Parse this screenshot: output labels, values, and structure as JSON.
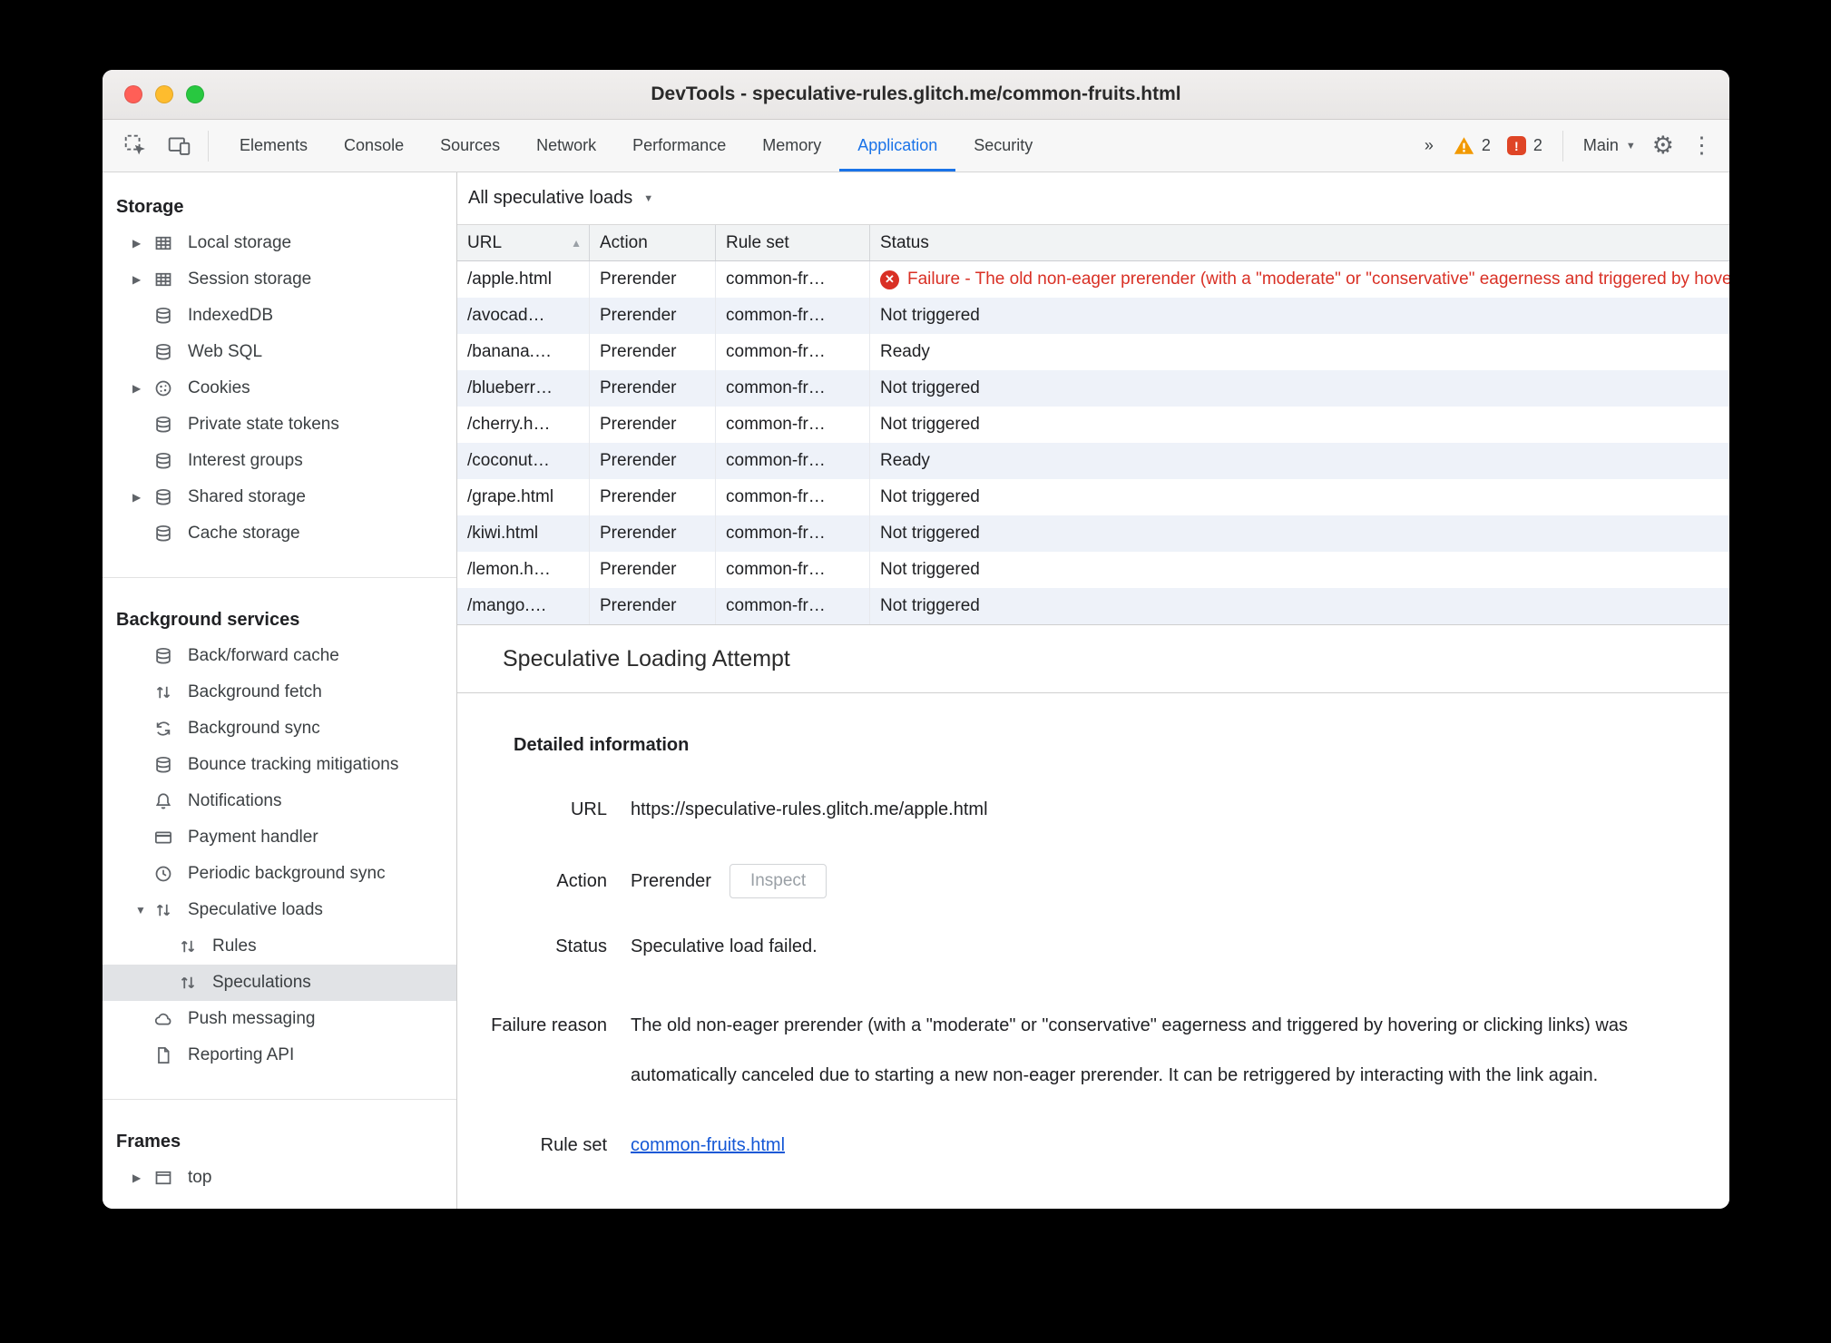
{
  "window": {
    "title": "DevTools - speculative-rules.glitch.me/common-fruits.html"
  },
  "toolbar": {
    "tabs": {
      "elements": "Elements",
      "console": "Console",
      "sources": "Sources",
      "network": "Network",
      "performance": "Performance",
      "memory": "Memory",
      "application": "Application",
      "security": "Security"
    },
    "more_tabs_symbol": "»",
    "warning_count": "2",
    "issue_count": "2",
    "main_menu_label": "Main"
  },
  "sidebar": {
    "storage": {
      "title": "Storage",
      "items": [
        "Local storage",
        "Session storage",
        "IndexedDB",
        "Web SQL",
        "Cookies",
        "Private state tokens",
        "Interest groups",
        "Shared storage",
        "Cache storage"
      ]
    },
    "background": {
      "title": "Background services",
      "items": [
        "Back/forward cache",
        "Background fetch",
        "Background sync",
        "Bounce tracking mitigations",
        "Notifications",
        "Payment handler",
        "Periodic background sync",
        "Speculative loads",
        "Rules",
        "Speculations",
        "Push messaging",
        "Reporting API"
      ]
    },
    "frames": {
      "title": "Frames",
      "items": [
        "top"
      ]
    }
  },
  "filter": {
    "label": "All speculative loads"
  },
  "grid": {
    "columns": {
      "url": "URL",
      "action": "Action",
      "rule_set": "Rule set",
      "status": "Status"
    },
    "rows": [
      {
        "url": "/apple.html",
        "action": "Prerender",
        "rule_set": "common-fr…",
        "status": "Failure - The old non-eager prerender (with a \"moderate\" or \"conservative\" eagerness and triggered by hovering or clicking links) was automatically canceled"
      },
      {
        "url": "/avocad…",
        "action": "Prerender",
        "rule_set": "common-fr…",
        "status": "Not triggered"
      },
      {
        "url": "/banana.…",
        "action": "Prerender",
        "rule_set": "common-fr…",
        "status": "Ready"
      },
      {
        "url": "/blueberr…",
        "action": "Prerender",
        "rule_set": "common-fr…",
        "status": "Not triggered"
      },
      {
        "url": "/cherry.h…",
        "action": "Prerender",
        "rule_set": "common-fr…",
        "status": "Not triggered"
      },
      {
        "url": "/coconut…",
        "action": "Prerender",
        "rule_set": "common-fr…",
        "status": "Ready"
      },
      {
        "url": "/grape.html",
        "action": "Prerender",
        "rule_set": "common-fr…",
        "status": "Not triggered"
      },
      {
        "url": "/kiwi.html",
        "action": "Prerender",
        "rule_set": "common-fr…",
        "status": "Not triggered"
      },
      {
        "url": "/lemon.h…",
        "action": "Prerender",
        "rule_set": "common-fr…",
        "status": "Not triggered"
      },
      {
        "url": "/mango.…",
        "action": "Prerender",
        "rule_set": "common-fr…",
        "status": "Not triggered"
      }
    ]
  },
  "details": {
    "panel_title": "Speculative Loading Attempt",
    "section_title": "Detailed information",
    "url": {
      "label": "URL",
      "value": "https://speculative-rules.glitch.me/apple.html"
    },
    "action": {
      "label": "Action",
      "value": "Prerender",
      "button": "Inspect"
    },
    "status": {
      "label": "Status",
      "value": "Speculative load failed."
    },
    "failure": {
      "label": "Failure reason",
      "value": "The old non-eager prerender (with a \"moderate\" or \"conservative\" eagerness and triggered by hovering or clicking links) was automatically canceled due to starting a new non-eager prerender. It can be retriggered by interacting with the link again."
    },
    "rule_set": {
      "label": "Rule set",
      "value": "common-fruits.html"
    }
  },
  "colors": {
    "accent": "#1a73e8",
    "failure": "#d93025",
    "warning": "#f29900"
  }
}
